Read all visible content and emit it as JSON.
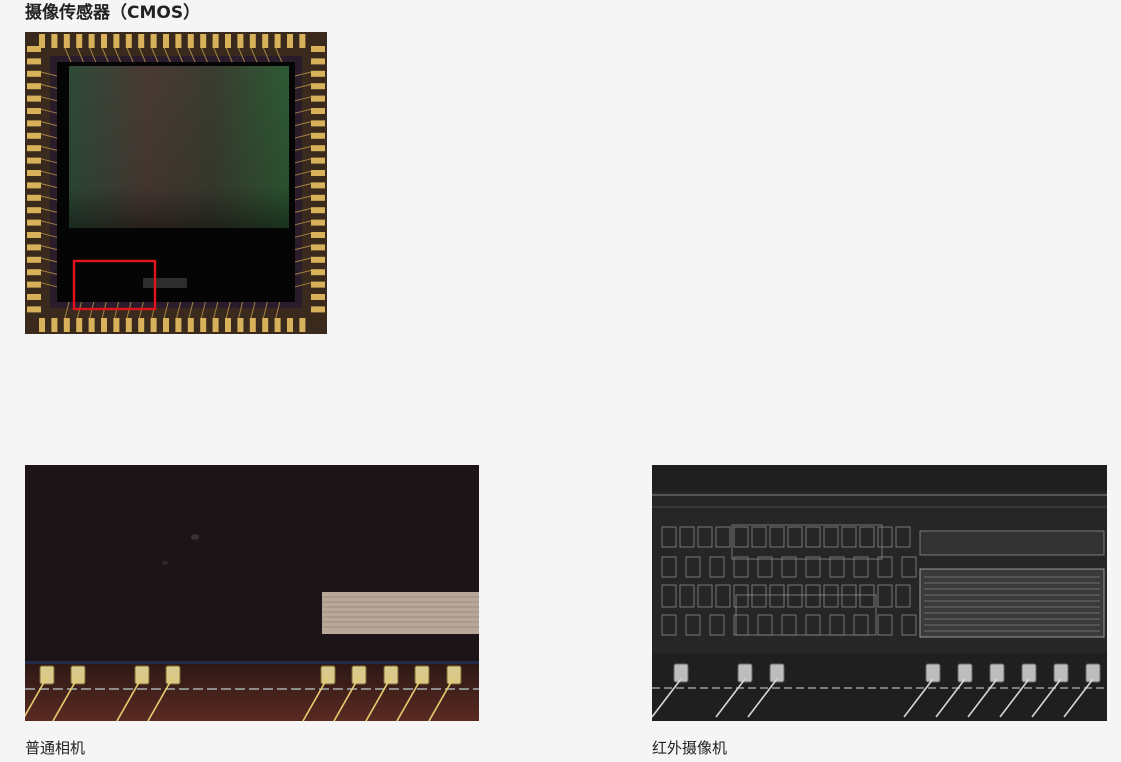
{
  "section": {
    "title": "摄像传感器（CMOS）"
  },
  "figures": {
    "chip": {
      "icon": "cmos-chip-photo",
      "highlight_color": "#e0141a"
    },
    "normal": {
      "icon": "normal-camera-die-photo",
      "caption": "普通相机"
    },
    "infrared": {
      "icon": "infrared-camera-die-photo",
      "caption": "红外摄像机"
    }
  }
}
